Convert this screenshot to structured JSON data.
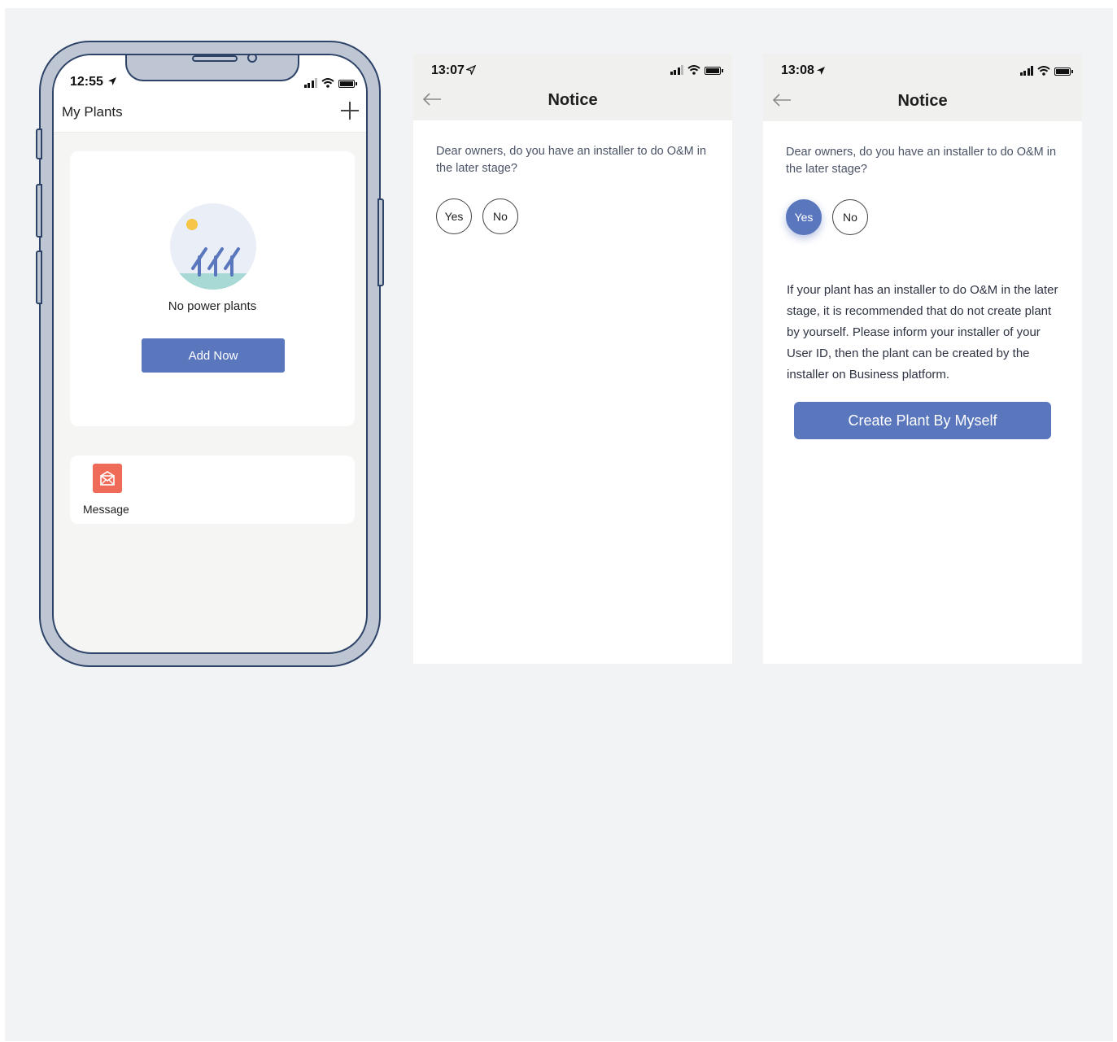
{
  "screen1": {
    "status_time": "12:55",
    "title": "My Plants",
    "empty_text": "No power plants",
    "add_button": "Add Now",
    "message_label": "Message"
  },
  "screen2": {
    "status_time": "13:07",
    "title": "Notice",
    "question": "Dear owners, do you have an installer to do O&M in the later stage?",
    "yes_label": "Yes",
    "no_label": "No"
  },
  "screen3": {
    "status_time": "13:08",
    "title": "Notice",
    "question": "Dear owners, do you have an installer to do O&M in the later stage?",
    "yes_label": "Yes",
    "no_label": "No",
    "selected": "Yes",
    "info": "If your plant has an installer to do O&M in the later stage, it is recommended that do not create plant by yourself. Please inform your installer of your User ID, then the plant can be created by the installer on Business platform.",
    "create_button": "Create Plant By Myself"
  },
  "colors": {
    "accent": "#5a77bd",
    "message_icon": "#ef6b57",
    "phone_frame": "#2e4368"
  },
  "icons": {
    "location_arrow": "location-arrow-icon",
    "signal": "signal-icon",
    "wifi": "wifi-icon",
    "battery": "battery-icon",
    "add": "plus-icon",
    "back": "back-arrow-icon",
    "message": "envelope-icon",
    "empty_state": "solar-panels-illustration"
  }
}
